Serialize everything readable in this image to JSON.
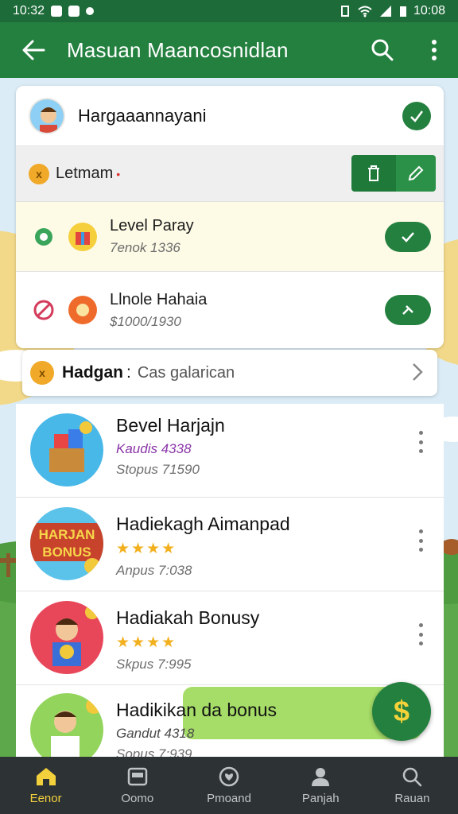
{
  "status_bar": {
    "time": "10:32",
    "right_time": "10:08"
  },
  "app_bar": {
    "title": "Masuan Maancosnidlan"
  },
  "user": {
    "name": "Hargaaannayani"
  },
  "section": {
    "label": "Letmam"
  },
  "items": [
    {
      "title": "Level Paray",
      "subtitle": "7enok 1336"
    },
    {
      "title": "Llnole Hahaia",
      "subtitle": "$1000/1930"
    }
  ],
  "category": {
    "label": "Hadgan",
    "separator": ":",
    "value": "Cas galarican"
  },
  "list": [
    {
      "title": "Bevel Harjajn",
      "sub": "Kaudis 4338",
      "meta": "Stopus 71590",
      "stars": "",
      "thumb": "gift-boxes"
    },
    {
      "title": "Hadiekagh Aimanpad",
      "sub": "",
      "meta": "Anpus 7:038",
      "stars": "★★★★",
      "thumb": "hadiah-bonus-badge",
      "thumb_line1": "HARJAN",
      "thumb_line2": "BONUS"
    },
    {
      "title": "Hadiakah Bonusy",
      "sub": "",
      "meta": "Skpus 7:995",
      "stars": "★★★★",
      "thumb": "boy-with-coins"
    },
    {
      "title": "Hadikikan da bonus",
      "sub": "Gandut 4318",
      "meta": "Sopus 7:939",
      "stars": "",
      "thumb": "boy-holding-coin"
    }
  ],
  "fab": {
    "symbol": "$"
  },
  "bottom_nav": [
    {
      "label": "Eenor",
      "icon": "home-icon",
      "active": true
    },
    {
      "label": "Oomo",
      "icon": "card-icon",
      "active": false
    },
    {
      "label": "Pmoand",
      "icon": "heart-badge-icon",
      "active": false
    },
    {
      "label": "Panjah",
      "icon": "person-icon",
      "active": false
    },
    {
      "label": "Rauan",
      "icon": "search-icon",
      "active": false
    }
  ],
  "colors": {
    "primary": "#24803f",
    "primary_dark": "#1e6b3a",
    "accent_yellow": "#f3d13c",
    "highlight_green": "#a6dd68",
    "nav_bg": "#2d3235"
  }
}
